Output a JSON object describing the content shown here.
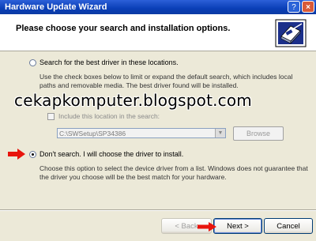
{
  "window": {
    "title": "Hardware Update Wizard",
    "help_button": "?",
    "close_button": "×"
  },
  "header": {
    "title": "Please choose your search and installation options.",
    "icon": "hardware-wizard-icon"
  },
  "options": {
    "search": {
      "label": "Search for the best driver in these locations.",
      "selected": false,
      "description_line1": "Use the check boxes below to limit or expand the default search, which includes local",
      "description_line2": "paths and removable media. The best driver found will be installed.",
      "include_location_label": "Include this location in the search:",
      "path_value": "C:\\SWSetup\\SP34386",
      "browse_label": "Browse"
    },
    "dont_search": {
      "label": "Don't search. I will choose the driver to install.",
      "selected": true,
      "description_line1": "Choose this option to select the device driver from a list.  Windows does not guarantee that",
      "description_line2": "the driver you choose will be the best match for your hardware."
    }
  },
  "watermark": "cekapkomputer.blogspot.com",
  "annotations": {
    "arrow_color": "#e8140c"
  },
  "buttons": {
    "back": "< Back",
    "next": "Next >",
    "cancel": "Cancel"
  }
}
